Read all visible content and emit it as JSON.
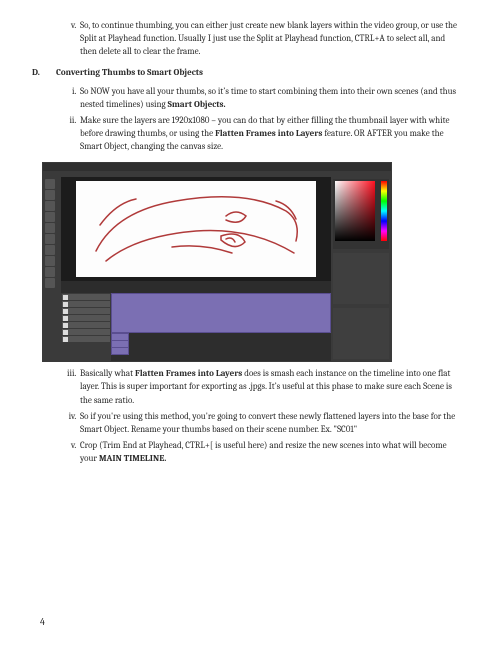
{
  "intro_list": {
    "start": 5,
    "items": [
      "So, to continue thumbing, you can either just create new blank layers within the video group, or use the Split at Playhead function. Usually I just use the Split at Playhead function, CTRL+A to select all, and then delete all to clear the frame."
    ]
  },
  "section": {
    "letter": "D.",
    "title": "Converting Thumbs to Smart Objects"
  },
  "list_a": {
    "items": [
      {
        "pre": "So NOW you have all your thumbs, so it’s time to start combining them into their own scenes (and thus nested timelines) using ",
        "b": "Smart Objects.",
        "post": ""
      },
      {
        "pre": "Make sure the layers are 1920x1080 – you can do that by either filling the thumbnail layer with white before drawing thumbs, or using the ",
        "b": "Flatten Frames into Layers",
        "post": " feature. OR AFTER you make the Smart Object, changing the canvas size."
      }
    ]
  },
  "list_b": {
    "start": 3,
    "items": [
      {
        "pre": "Basically what ",
        "b": "Flatten Frames into Layers",
        "post": " does is smash each instance on the timeline into one flat layer. This is super important for exporting as .jpgs. It’s useful at this phase to make sure each Scene is the same ratio."
      },
      {
        "pre": "So if you're using this method, you're going to convert these newly flattened layers into the base for the Smart Object. Rename your thumbs based on their scene number. Ex. \"SC01\"",
        "b": "",
        "post": ""
      },
      {
        "pre": "Crop (Trim End at Playhead, CTRL+[ is useful here) and resize the new scenes into what will become your ",
        "b": "MAIN TIMELINE.",
        "post": ""
      }
    ]
  },
  "page_number": "4"
}
